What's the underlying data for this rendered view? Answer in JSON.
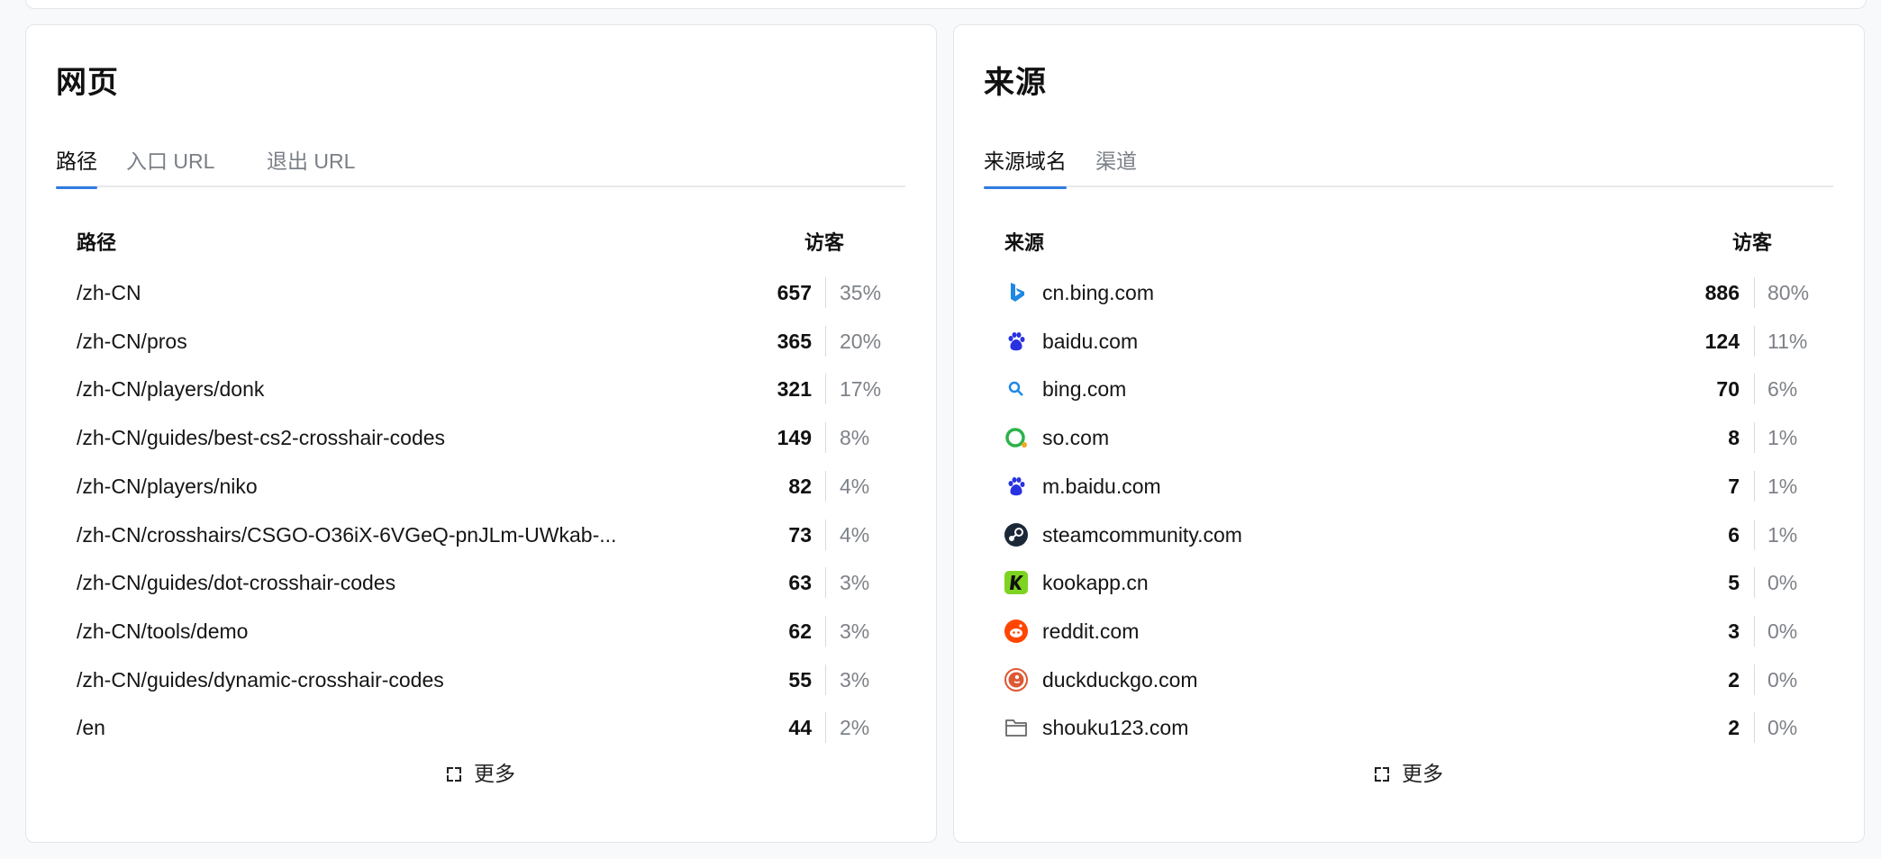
{
  "pages": {
    "title": "网页",
    "tabs": [
      "路径",
      "入口 URL",
      "退出 URL"
    ],
    "columns": {
      "label": "路径",
      "value": "访客"
    },
    "rows": [
      {
        "label": "/zh-CN",
        "count": "657",
        "pct": "35%"
      },
      {
        "label": "/zh-CN/pros",
        "count": "365",
        "pct": "20%"
      },
      {
        "label": "/zh-CN/players/donk",
        "count": "321",
        "pct": "17%"
      },
      {
        "label": "/zh-CN/guides/best-cs2-crosshair-codes",
        "count": "149",
        "pct": "8%"
      },
      {
        "label": "/zh-CN/players/niko",
        "count": "82",
        "pct": "4%"
      },
      {
        "label": "/zh-CN/crosshairs/CSGO-O36iX-6VGeQ-pnJLm-UWkab-...",
        "count": "73",
        "pct": "4%"
      },
      {
        "label": "/zh-CN/guides/dot-crosshair-codes",
        "count": "63",
        "pct": "3%"
      },
      {
        "label": "/zh-CN/tools/demo",
        "count": "62",
        "pct": "3%"
      },
      {
        "label": "/zh-CN/guides/dynamic-crosshair-codes",
        "count": "55",
        "pct": "3%"
      },
      {
        "label": "/en",
        "count": "44",
        "pct": "2%"
      }
    ],
    "more_label": "更多"
  },
  "sources": {
    "title": "来源",
    "tabs": [
      "来源域名",
      "渠道"
    ],
    "columns": {
      "label": "来源",
      "value": "访客"
    },
    "rows": [
      {
        "label": "cn.bing.com",
        "count": "886",
        "pct": "80%",
        "icon": "bing-icon"
      },
      {
        "label": "baidu.com",
        "count": "124",
        "pct": "11%",
        "icon": "baidu-icon"
      },
      {
        "label": "bing.com",
        "count": "70",
        "pct": "6%",
        "icon": "search-icon"
      },
      {
        "label": "so.com",
        "count": "8",
        "pct": "1%",
        "icon": "so-icon"
      },
      {
        "label": "m.baidu.com",
        "count": "7",
        "pct": "1%",
        "icon": "baidu-icon"
      },
      {
        "label": "steamcommunity.com",
        "count": "6",
        "pct": "1%",
        "icon": "steam-icon"
      },
      {
        "label": "kookapp.cn",
        "count": "5",
        "pct": "0%",
        "icon": "kook-icon"
      },
      {
        "label": "reddit.com",
        "count": "3",
        "pct": "0%",
        "icon": "reddit-icon"
      },
      {
        "label": "duckduckgo.com",
        "count": "2",
        "pct": "0%",
        "icon": "duckduckgo-icon"
      },
      {
        "label": "shouku123.com",
        "count": "2",
        "pct": "0%",
        "icon": "folder-icon"
      }
    ],
    "more_label": "更多"
  },
  "colors": {
    "accent": "#2f7de1",
    "bing": "#1e88e5",
    "baidu": "#2932e1",
    "so": "#2db34a",
    "steam": "#1b2838",
    "kook": "#7ed321",
    "reddit": "#ff4500",
    "duckduckgo": "#de5833"
  }
}
